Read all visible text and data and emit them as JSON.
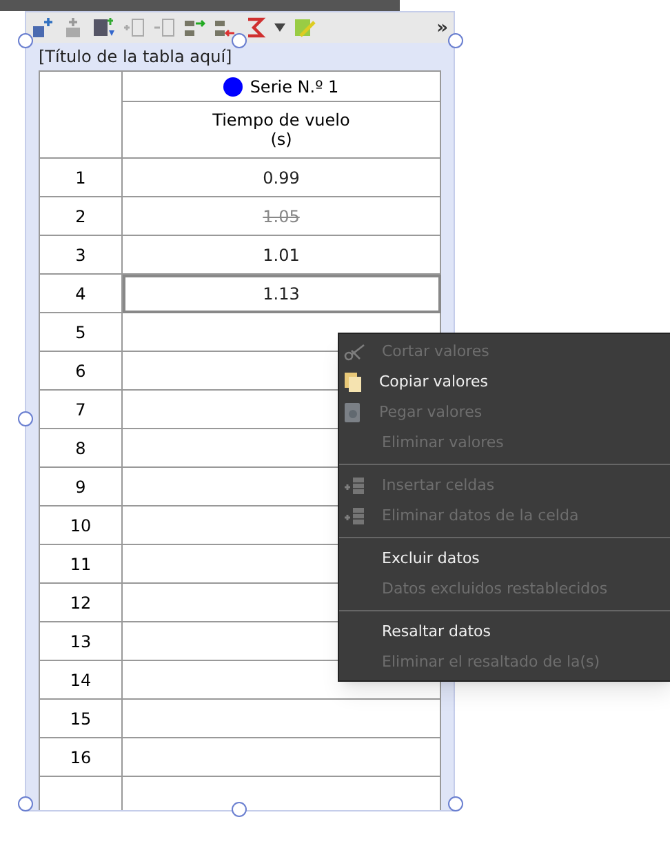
{
  "toolbar": {
    "overflow": "»"
  },
  "table": {
    "title": "[Título de la tabla aquí]",
    "series": {
      "name": "Serie N.º 1",
      "color": "#0000ff"
    },
    "column": {
      "heading": "Tiempo de vuelo",
      "unit": "(s)"
    },
    "rows": [
      {
        "number": "1",
        "value": "0.99",
        "excluded": false,
        "selected": false
      },
      {
        "number": "2",
        "value": "1.05",
        "excluded": true,
        "selected": false
      },
      {
        "number": "3",
        "value": "1.01",
        "excluded": false,
        "selected": false
      },
      {
        "number": "4",
        "value": "1.13",
        "excluded": false,
        "selected": true
      },
      {
        "number": "5"
      },
      {
        "number": "6"
      },
      {
        "number": "7"
      },
      {
        "number": "8"
      },
      {
        "number": "9"
      },
      {
        "number": "10"
      },
      {
        "number": "11"
      },
      {
        "number": "12"
      },
      {
        "number": "13"
      },
      {
        "number": "14"
      },
      {
        "number": "15"
      },
      {
        "number": "16"
      }
    ]
  },
  "context_menu": [
    {
      "kind": "item",
      "label": "Cortar valores",
      "disabled": true
    },
    {
      "kind": "item",
      "label": "Copiar valores",
      "disabled": false
    },
    {
      "kind": "item",
      "label": "Pegar valores",
      "disabled": true
    },
    {
      "kind": "item",
      "label": "Eliminar valores",
      "disabled": true
    },
    {
      "kind": "separator"
    },
    {
      "kind": "item",
      "label": "Insertar celdas",
      "disabled": true
    },
    {
      "kind": "item",
      "label": "Eliminar datos de la celda",
      "disabled": true
    },
    {
      "kind": "separator"
    },
    {
      "kind": "item",
      "label": "Excluir datos",
      "disabled": false
    },
    {
      "kind": "item",
      "label": "Datos excluidos restablecidos",
      "disabled": true
    },
    {
      "kind": "separator"
    },
    {
      "kind": "item",
      "label": "Resaltar datos",
      "disabled": false
    },
    {
      "kind": "item",
      "label": "Eliminar el resaltado de la(s)",
      "disabled": true
    }
  ]
}
